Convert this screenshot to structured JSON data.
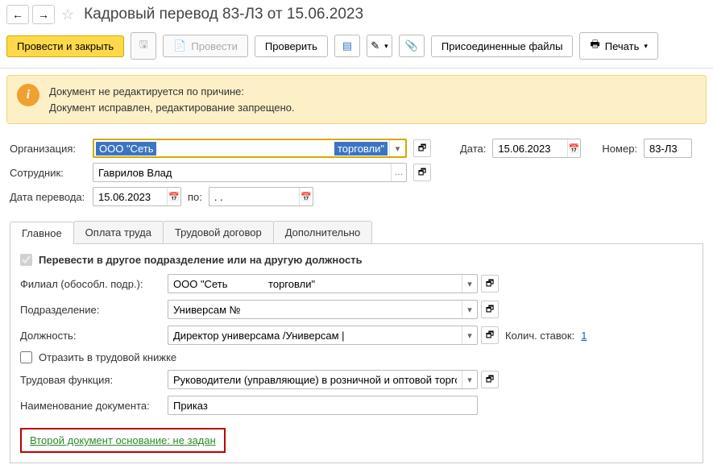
{
  "header": {
    "title": "Кадровый перевод 83-Л3 от 15.06.2023"
  },
  "toolbar": {
    "post_close": "Провести и закрыть",
    "post": "Провести",
    "verify": "Проверить",
    "attached_files": "Присоединенные файлы",
    "print": "Печать"
  },
  "warning": {
    "line1": "Документ не редактируется по причине:",
    "line2": "Документ исправлен, редактирование запрещено."
  },
  "fields": {
    "organization_label": "Организация:",
    "organization_value_p1": "ООО \"Сеть",
    "organization_value_p2": "торговли\"",
    "date_label": "Дата:",
    "date_value": "15.06.2023",
    "number_label": "Номер:",
    "number_value": "83-Л3",
    "employee_label": "Сотрудник:",
    "employee_value": "Гаврилов Влад",
    "transfer_date_label": "Дата перевода:",
    "transfer_date_value": "15.06.2023",
    "to_label": "по:",
    "to_value": ". ."
  },
  "tabs": {
    "main": "Главное",
    "payment": "Оплата труда",
    "contract": "Трудовой договор",
    "additional": "Дополнительно"
  },
  "main_tab": {
    "transfer_checkbox": "Перевести в другое подразделение или на другую должность",
    "branch_label": "Филиал (обособл. подр.):",
    "branch_value": "ООО \"Сеть              торговли\"",
    "department_label": "Подразделение:",
    "department_value": "Универсам №",
    "position_label": "Должность:",
    "position_value": "Директор универсама /Универсам |",
    "rates_label": "Колич. ставок:",
    "rates_value": "1",
    "workbook_checkbox": "Отразить в трудовой книжке",
    "work_function_label": "Трудовая функция:",
    "work_function_value": "Руководители (управляющие) в розничной и оптовой торгов",
    "doc_name_label": "Наименование документа:",
    "doc_name_value": "Приказ",
    "second_doc_link": "Второй документ основание: не задан"
  }
}
